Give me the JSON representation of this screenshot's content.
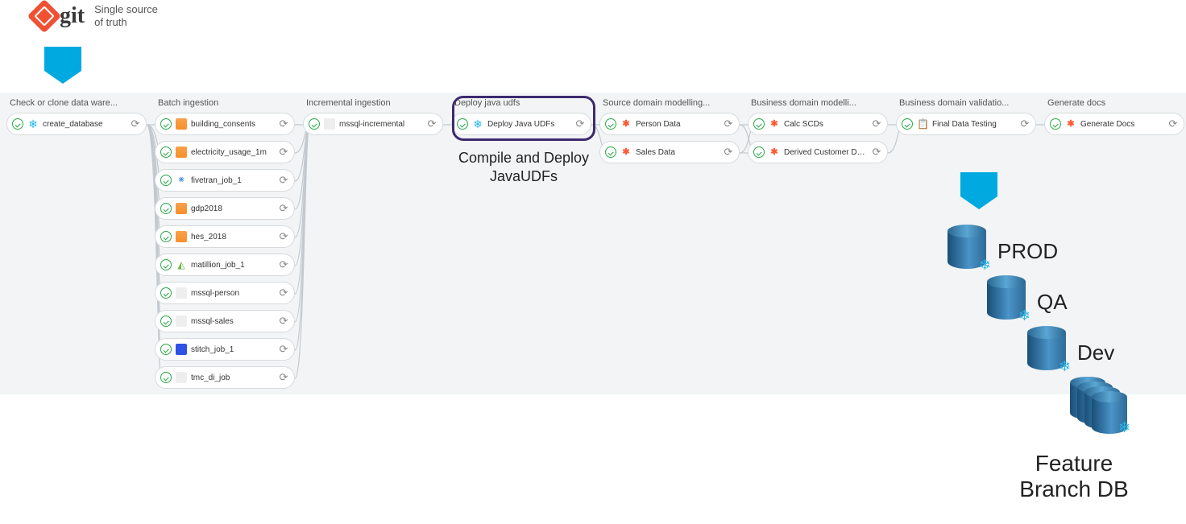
{
  "header": {
    "git_word": "git",
    "caption_line1": "Single source",
    "caption_line2": "of truth"
  },
  "highlight": {
    "caption": "Compile and Deploy JavaUDFs"
  },
  "columns": [
    {
      "title": "Check or clone data ware...",
      "tasks": [
        {
          "label": "create_database",
          "icon": "snowflake"
        }
      ]
    },
    {
      "title": "Batch ingestion",
      "tasks": [
        {
          "label": "building_consents",
          "icon": "orange"
        },
        {
          "label": "electricity_usage_1m",
          "icon": "orange"
        },
        {
          "label": "fivetran_job_1",
          "icon": "fivetran"
        },
        {
          "label": "gdp2018",
          "icon": "orange"
        },
        {
          "label": "hes_2018",
          "icon": "orange"
        },
        {
          "label": "matillion_job_1",
          "icon": "matillion"
        },
        {
          "label": "mssql-person",
          "icon": "mssql"
        },
        {
          "label": "mssql-sales",
          "icon": "mssql"
        },
        {
          "label": "stitch_job_1",
          "icon": "stitch"
        },
        {
          "label": "tmc_di_job",
          "icon": "tmc"
        }
      ]
    },
    {
      "title": "Incremental ingestion",
      "tasks": [
        {
          "label": "mssql-incremental",
          "icon": "mssql"
        }
      ]
    },
    {
      "title": "Deploy java udfs",
      "tasks": [
        {
          "label": "Deploy Java UDFs",
          "icon": "snowflake"
        }
      ]
    },
    {
      "title": "Source domain modelling...",
      "tasks": [
        {
          "label": "Person Data",
          "icon": "dbt"
        },
        {
          "label": "Sales Data",
          "icon": "dbt"
        }
      ]
    },
    {
      "title": "Business domain modelli...",
      "tasks": [
        {
          "label": "Calc SCDs",
          "icon": "dbt"
        },
        {
          "label": "Derived Customer Data",
          "icon": "dbt"
        }
      ]
    },
    {
      "title": "Business domain validatio...",
      "tasks": [
        {
          "label": "Final Data Testing",
          "icon": "clip"
        }
      ]
    },
    {
      "title": "Generate docs",
      "tasks": [
        {
          "label": "Generate Docs",
          "icon": "dbt"
        }
      ]
    }
  ],
  "databases": {
    "prod": "PROD",
    "qa": "QA",
    "dev": "Dev",
    "feature_line1": "Feature",
    "feature_line2": "Branch DB"
  }
}
